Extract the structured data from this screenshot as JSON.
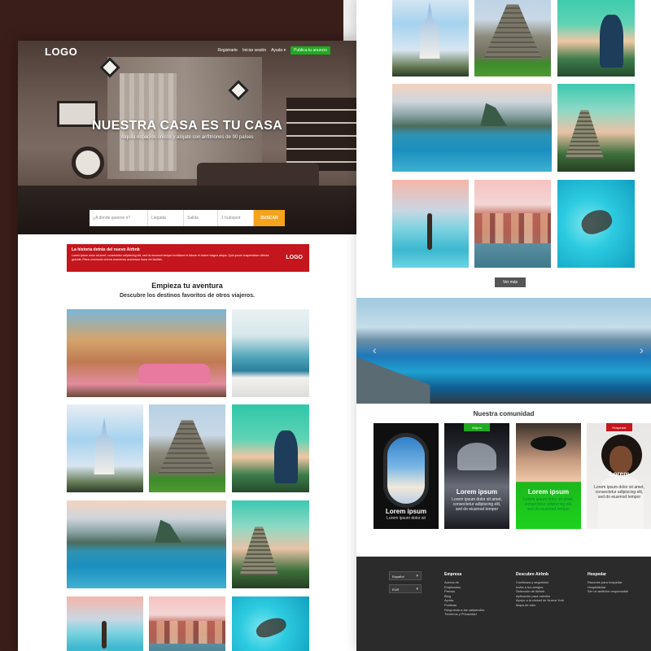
{
  "hero": {
    "logo": "LOGO",
    "nav": [
      "Registrarte",
      "Iniciar sesión",
      "Ayuda"
    ],
    "publish_label": "Publica tu anuncio",
    "title": "NUESTRA CASA ES TU CASA",
    "subtitle": "Alquila espacios únicos y alójate con anfitriones de 90 países"
  },
  "search": {
    "where_placeholder": "¿A dónde quieres ir?",
    "checkin": "Llegada",
    "checkout": "Salida",
    "guests": "1 huésped",
    "button": "BUSCAR"
  },
  "promo": {
    "title": "La historia detrás del nuevo Airbnb",
    "body": "Lorem ipsum dolor sit amet, consectetur adipisicing elit, sed do eiusmod tempor incididunt ut labore et dolore magna aliqua. Quis ipsum suspendisse ultrices gravida. Risus commodo viverra maecenas accumsan lacus vel facilisis.",
    "logo": "LOGO"
  },
  "adventure": {
    "title": "Empieza tu aventura",
    "subtitle": "Descubre los destinos favoritos de otros viajeros."
  },
  "gallery_more": "Ver más",
  "community": {
    "title": "Nuestra comunidad",
    "cards": [
      {
        "badge": "",
        "title": "Lorem ipsum",
        "body": "Lorem ipsum dolor sit",
        "badge_color": ""
      },
      {
        "badge": "Viajero",
        "title": "Lorem ipsum",
        "body": "Lorem ipsum dolor sit amet, consectetur adipiscing elit, sed do eiusmod tempor",
        "badge_color": "#1faa1f"
      },
      {
        "badge": "",
        "title": "Lorem ipsum",
        "body": "Lorem ipsum dolor sit amet, consectetur adipiscing elit, sed do eiusmod tempor",
        "badge_color": ""
      },
      {
        "badge": "Hospedar",
        "title": "Lorem",
        "body": "Lorem ipsum dolor sit amet, consectetur adipiscing elit, sed do eiusmod tempor",
        "badge_color": "#c4161c"
      }
    ]
  },
  "footer": {
    "language": "Español",
    "currency": "EUR",
    "columns": [
      {
        "heading": "Empresa",
        "links": [
          "Acerca de",
          "Empleados",
          "Prensa",
          "Blog",
          "Ayuda",
          "Políticas",
          "Respuesta a las catástrofes",
          "Términos y Privacidad"
        ]
      },
      {
        "heading": "Descubre Airbnb",
        "links": [
          "Confianza y seguridad",
          "Invita a tus amigos",
          "Selección de Airbnb",
          "Aplicación para móviles",
          "Apoyo a la ciudad de Nueva York",
          "Mapa de sitio"
        ]
      },
      {
        "heading": "Hospedar",
        "links": [
          "Razones para hospedar",
          "Hospitalidad",
          "Ser un anfitrión responsable"
        ]
      }
    ]
  },
  "colors": {
    "brand_red": "#c4161c",
    "search_button": "#f4a31a",
    "publish_green": "#1faa1f",
    "backdrop": "#3a1e19",
    "footer_bg": "#2b2b2b"
  },
  "icons": [
    "chevron-down-icon",
    "arrow-left-icon",
    "arrow-right-icon"
  ]
}
